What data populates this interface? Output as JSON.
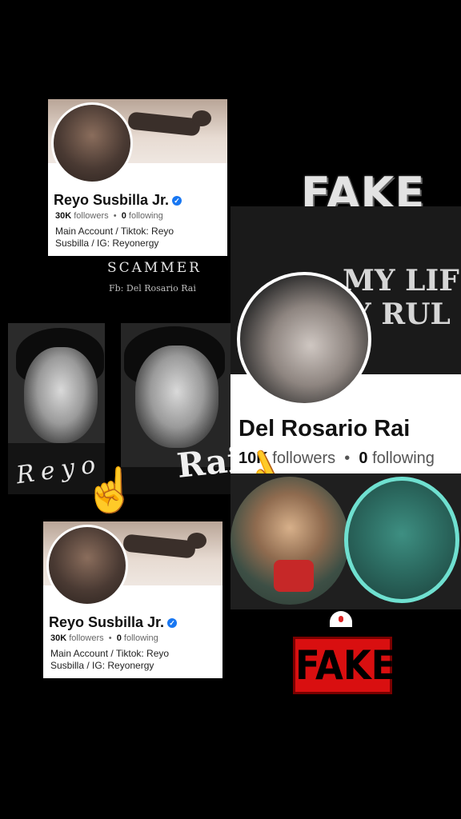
{
  "top_card": {
    "name": "Reyo Susbilla Jr.",
    "followers_count": "30K",
    "followers_label": "followers",
    "following_count": "0",
    "following_label": "following",
    "bio": "Main Account / Tiktok: Reyo Susbilla / IG: Reyonergy"
  },
  "scammer_label": "SCAMMER",
  "scammer_fb": "Fb: Del Rosario Rai",
  "left_photo_caption": "Reyo",
  "middle_photo_caption": "Rai",
  "bottom_card": {
    "name": "Reyo Susbilla Jr.",
    "followers_count": "30K",
    "followers_label": "followers",
    "following_count": "0",
    "following_label": "following",
    "bio": "Main Account / Tiktok: Reyo Susbilla / IG: Reyonergy"
  },
  "fake_top": "FAKE",
  "fake_bottom": "FAKE",
  "rai_profile": {
    "bg_line1": "MY LIF",
    "bg_line2": "Y RUL",
    "name": "Del Rosario Rai",
    "followers_count": "10K",
    "followers_label": "followers",
    "following_count": "0",
    "following_label": "following"
  },
  "colors": {
    "verified": "#1877f2",
    "fake_box": "#d90f10",
    "background": "#000000"
  },
  "icons": [
    "verified-badge-icon",
    "pointing-hand-icon",
    "pointing-hand-left-icon"
  ]
}
